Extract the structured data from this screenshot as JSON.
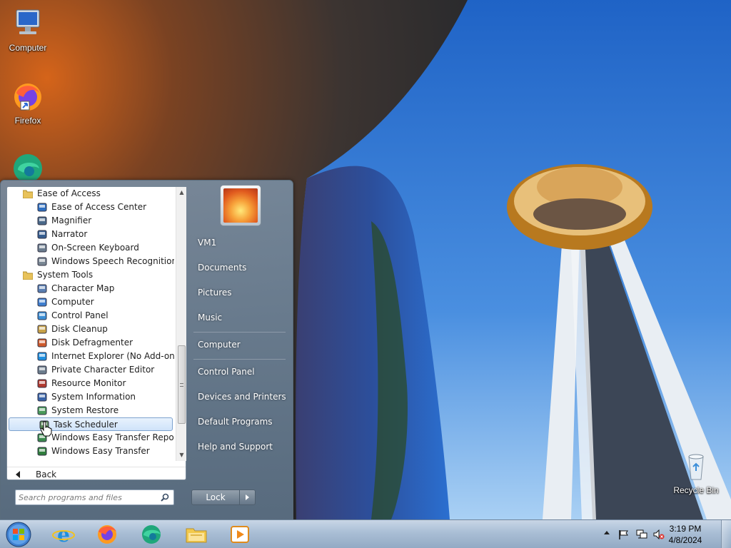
{
  "desktop": {
    "icons": [
      {
        "label": "Computer",
        "icon": "computer-icon"
      },
      {
        "label": "Firefox",
        "icon": "firefox-icon"
      },
      {
        "label": "Recycle Bin",
        "icon": "recycle-bin-icon"
      }
    ]
  },
  "start_menu": {
    "programs": [
      {
        "label": "Ease of Access",
        "type": "folder",
        "icon": "folder-icon"
      },
      {
        "label": "Ease of Access Center",
        "type": "item",
        "icon": "ease-of-access-icon"
      },
      {
        "label": "Magnifier",
        "type": "item",
        "icon": "magnifier-icon"
      },
      {
        "label": "Narrator",
        "type": "item",
        "icon": "narrator-icon"
      },
      {
        "label": "On-Screen Keyboard",
        "type": "item",
        "icon": "keyboard-icon"
      },
      {
        "label": "Windows Speech Recognition",
        "type": "item",
        "icon": "microphone-icon"
      },
      {
        "label": "System Tools",
        "type": "folder",
        "icon": "folder-icon"
      },
      {
        "label": "Character Map",
        "type": "item",
        "icon": "character-map-icon"
      },
      {
        "label": "Computer",
        "type": "item",
        "icon": "computer-icon"
      },
      {
        "label": "Control Panel",
        "type": "item",
        "icon": "control-panel-icon"
      },
      {
        "label": "Disk Cleanup",
        "type": "item",
        "icon": "disk-cleanup-icon"
      },
      {
        "label": "Disk Defragmenter",
        "type": "item",
        "icon": "defragmenter-icon"
      },
      {
        "label": "Internet Explorer (No Add-ons)",
        "type": "item",
        "icon": "internet-explorer-icon"
      },
      {
        "label": "Private Character Editor",
        "type": "item",
        "icon": "character-editor-icon"
      },
      {
        "label": "Resource Monitor",
        "type": "item",
        "icon": "resource-monitor-icon"
      },
      {
        "label": "System Information",
        "type": "item",
        "icon": "system-information-icon"
      },
      {
        "label": "System Restore",
        "type": "item",
        "icon": "system-restore-icon"
      },
      {
        "label": "Task Scheduler",
        "type": "item",
        "icon": "task-scheduler-icon",
        "selected": true
      },
      {
        "label": "Windows Easy Transfer Reports",
        "type": "item",
        "icon": "transfer-reports-icon"
      },
      {
        "label": "Windows Easy Transfer",
        "type": "item",
        "icon": "easy-transfer-icon"
      }
    ],
    "back_label": "Back",
    "search_placeholder": "Search programs and files",
    "right_items": [
      {
        "label": "VM1"
      },
      {
        "label": "Documents"
      },
      {
        "label": "Pictures"
      },
      {
        "label": "Music"
      },
      {
        "label": "Computer"
      },
      {
        "label": "Control Panel"
      },
      {
        "label": "Devices and Printers"
      },
      {
        "label": "Default Programs"
      },
      {
        "label": "Help and Support"
      }
    ],
    "lock_label": "Lock"
  },
  "taskbar": {
    "pinned": [
      {
        "icon": "internet-explorer-icon"
      },
      {
        "icon": "firefox-icon"
      },
      {
        "icon": "edge-icon"
      },
      {
        "icon": "file-explorer-icon"
      },
      {
        "icon": "media-player-icon"
      }
    ],
    "clock_time": "3:19 PM",
    "clock_date": "4/8/2024"
  },
  "colors": {
    "selection": "#cfe3fa",
    "taskbar": "#a9bed5"
  }
}
